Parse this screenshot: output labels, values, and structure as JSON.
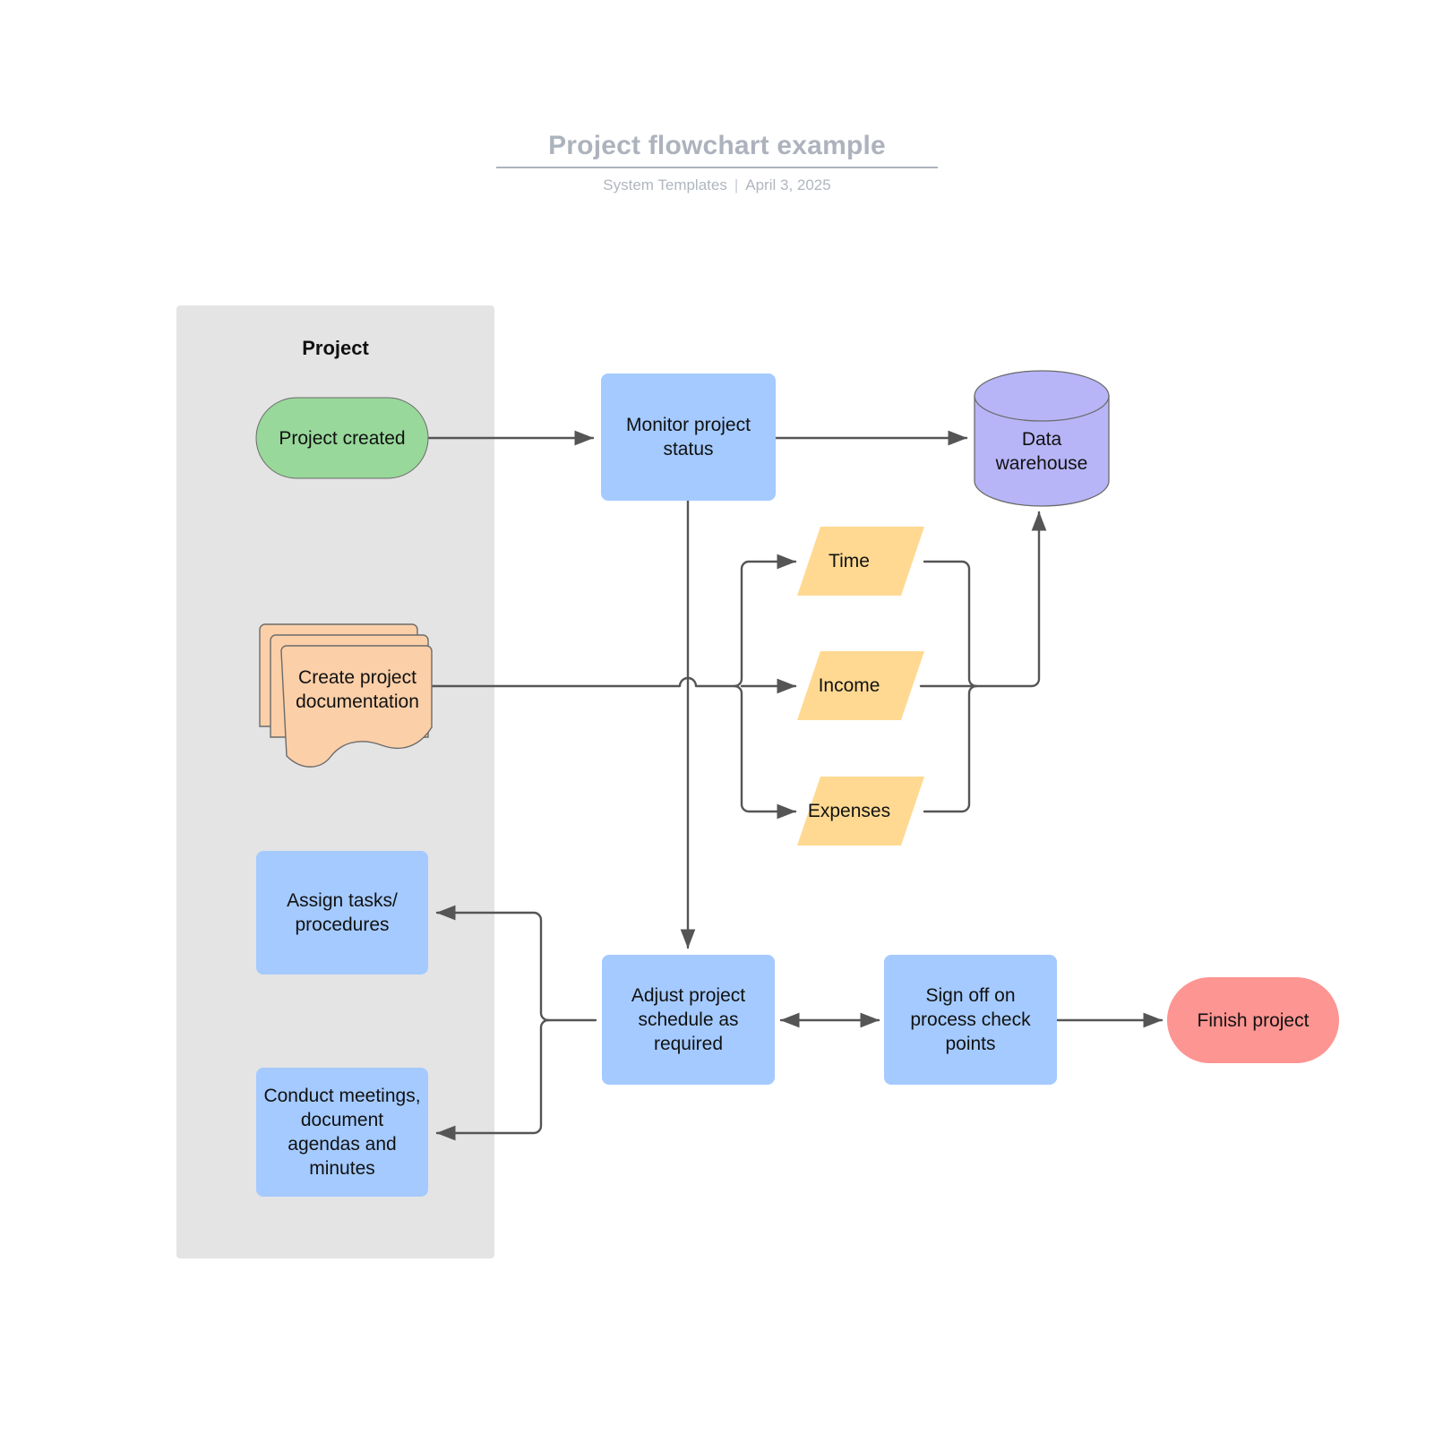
{
  "header": {
    "title": "Project flowchart example",
    "author": "System Templates",
    "separator": "|",
    "date": "April 3, 2025"
  },
  "colors": {
    "group_fill": "#e4e4e4",
    "green": "#98d89a",
    "blue": "#a4caff",
    "orange": "#ffd992",
    "peach": "#fbcfa8",
    "purple": "#b7b5f7",
    "salmon": "#fd9592",
    "stroke": "#555555",
    "edge": "#555555",
    "title_gray": "#adb3bd"
  },
  "group": {
    "label": "Project"
  },
  "nodes": {
    "project_created": {
      "label": "Project created",
      "shape": "terminator",
      "color": "#98d89a"
    },
    "create_documentation": {
      "label": "Create project\ndocumentation",
      "shape": "multi-document",
      "color": "#fbcfa8"
    },
    "assign_tasks": {
      "label": "Assign tasks/\nprocedures",
      "shape": "process",
      "color": "#a4caff"
    },
    "conduct_meetings": {
      "label": "Conduct meetings,\ndocument\nagendas and\nminutes",
      "shape": "process",
      "color": "#a4caff"
    },
    "monitor_status": {
      "label": "Monitor project\nstatus",
      "shape": "process",
      "color": "#a4caff"
    },
    "data_warehouse": {
      "label": "Data\nwarehouse",
      "shape": "cylinder",
      "color": "#b7b5f7"
    },
    "time": {
      "label": "Time",
      "shape": "parallelogram",
      "color": "#ffd992"
    },
    "income": {
      "label": "Income",
      "shape": "parallelogram",
      "color": "#ffd992"
    },
    "expenses": {
      "label": "Expenses",
      "shape": "parallelogram",
      "color": "#ffd992"
    },
    "adjust_schedule": {
      "label": "Adjust project\nschedule as\nrequired",
      "shape": "process",
      "color": "#a4caff"
    },
    "sign_off": {
      "label": "Sign off on\nprocess check\npoints",
      "shape": "process",
      "color": "#a4caff"
    },
    "finish_project": {
      "label": "Finish project",
      "shape": "terminator",
      "color": "#fd9592"
    }
  },
  "edges": [
    {
      "from": "project_created",
      "to": "monitor_status",
      "arrow": "single"
    },
    {
      "from": "monitor_status",
      "to": "data_warehouse",
      "arrow": "single"
    },
    {
      "from": "monitor_status",
      "to": "adjust_schedule",
      "arrow": "single"
    },
    {
      "from": "create_documentation",
      "to": "time",
      "arrow": "single"
    },
    {
      "from": "create_documentation",
      "to": "income",
      "arrow": "single"
    },
    {
      "from": "create_documentation",
      "to": "expenses",
      "arrow": "single"
    },
    {
      "from": "time",
      "to": "data_warehouse",
      "arrow": "single"
    },
    {
      "from": "income",
      "to": "data_warehouse",
      "arrow": "single"
    },
    {
      "from": "expenses",
      "to": "data_warehouse",
      "arrow": "single"
    },
    {
      "from": "adjust_schedule",
      "to": "sign_off",
      "arrow": "double"
    },
    {
      "from": "sign_off",
      "to": "finish_project",
      "arrow": "single"
    },
    {
      "from": "adjust_schedule",
      "to": "assign_tasks",
      "arrow": "single"
    },
    {
      "from": "adjust_schedule",
      "to": "conduct_meetings",
      "arrow": "single"
    }
  ]
}
